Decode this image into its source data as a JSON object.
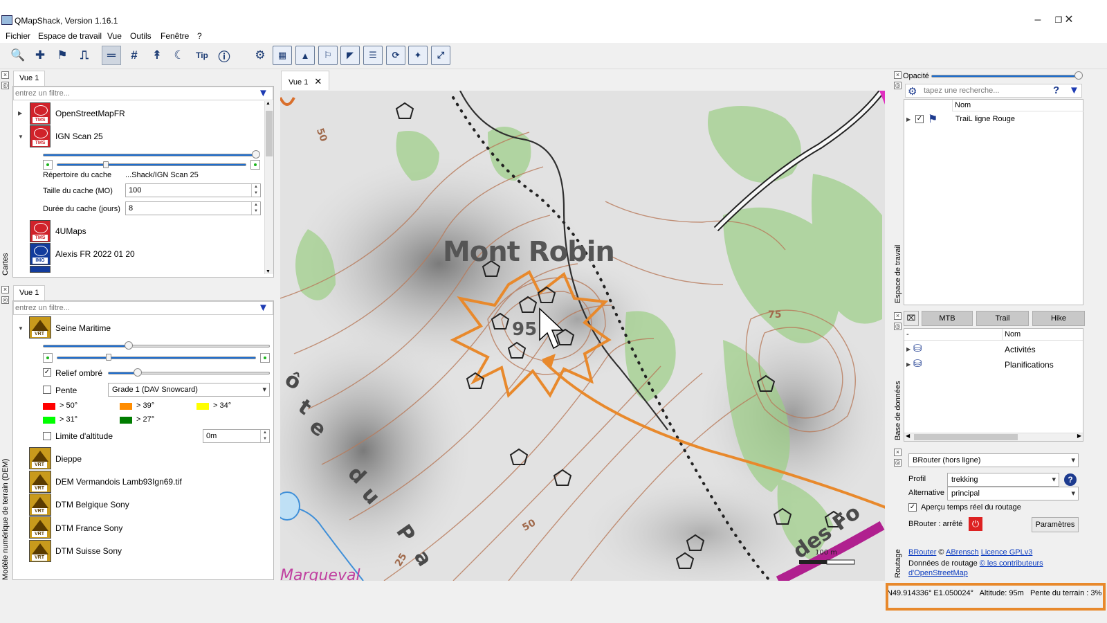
{
  "window": {
    "title": "QMapShack, Version 1.16.1"
  },
  "menu": [
    "Fichier",
    "Espace de travail",
    "Vue",
    "Outils",
    "Fenêtre",
    "?"
  ],
  "maps_dock": {
    "side_label": "Cartes",
    "tab": "Vue 1",
    "filter_placeholder": "entrez un filtre...",
    "items": [
      {
        "name": "OpenStreetMapFR",
        "type": "TMS"
      },
      {
        "name": "IGN Scan 25",
        "type": "TMS"
      },
      {
        "name": "4UMaps",
        "type": "TMS"
      },
      {
        "name": "Alexis FR 2022 01 20",
        "type": "IMG"
      }
    ],
    "cache_dir_label": "Répertoire du cache",
    "cache_dir_value": "...Shack/IGN Scan 25",
    "cache_size_label": "Taille du cache (MO)",
    "cache_size_value": "100",
    "cache_days_label": "Durée du cache (jours)",
    "cache_days_value": "8",
    "opacity_level": 0.98
  },
  "dem_dock": {
    "side_label": "Modèle numérique de terrain (DEM)",
    "tab": "Vue 1",
    "filter_placeholder": "entrez un filtre...",
    "items": [
      {
        "name": "Seine Maritime",
        "type": "VRT"
      },
      {
        "name": "Dieppe",
        "type": "VRT"
      },
      {
        "name": "DEM Vermandois Lamb93Ign69.tif",
        "type": "VRT"
      },
      {
        "name": "DTM Belgique Sony",
        "type": "VRT"
      },
      {
        "name": "DTM France Sony",
        "type": "VRT"
      },
      {
        "name": "DTM Suisse Sony",
        "type": "VRT"
      }
    ],
    "hillshade_label": "Relief ombré",
    "slope_label": "Pente",
    "slope_option": "Grade 1 (DAV Snowcard)",
    "slope_legend": [
      "> 50°",
      "> 39°",
      "> 34°",
      "> 31°",
      "> 27°"
    ],
    "slope_colors": [
      "#ff0000",
      "#ff8c00",
      "#ffff00",
      "#00ff00",
      "#007d00"
    ],
    "alt_limit_label": "Limite d'altitude",
    "alt_limit_value": "0m"
  },
  "map_view": {
    "tab": "Vue 1",
    "peak_label": "Mont Robin",
    "peak_alt": "95",
    "contour_labels": [
      "50",
      "75",
      "50",
      "25"
    ],
    "scale_label": "100 m",
    "road_label_letters": [
      "ô",
      "t",
      "e",
      "d",
      "u",
      "P",
      "a"
    ],
    "road_label_2": "des Fo",
    "village": "Marqueval"
  },
  "workspace_dock": {
    "side_label": "Espace de travail",
    "opacity_label": "Opacité",
    "opacity_level": 1.0,
    "search_placeholder": "tapez une recherche...",
    "help": "?",
    "column": "Nom",
    "items": [
      {
        "name": "TraiL ligne Rouge",
        "checked": true
      }
    ]
  },
  "db_dock": {
    "side_label": "Base de données",
    "tabs": [
      "MTB",
      "Trail",
      "Hike"
    ],
    "column_left": "-",
    "column": "Nom",
    "items": [
      "Activités",
      "Planifications"
    ]
  },
  "routing_dock": {
    "side_label": "Routage",
    "engine": "BRouter (hors ligne)",
    "profile_label": "Profil",
    "profile_value": "trekking",
    "alternative_label": "Alternative",
    "alternative_value": "principal",
    "preview_label": "Aperçu temps réel du routage",
    "status_label": "BRouter : arrêté",
    "params_button": "Paramètres",
    "credit_link1": "BRouter",
    "credit_copy": "©",
    "credit_link2": "ABrensch",
    "credit_link3": "Licence GPLv3",
    "data_label": "Données de routage",
    "data_link": "© les contributeurs",
    "data_link2": "d'OpenStreetMap"
  },
  "status": {
    "coords": "N49.914336° E1.050024°",
    "altitude": "Altitude: 95m",
    "slope": "Pente du terrain : 3%"
  },
  "colors": {
    "accent": "#e8892c",
    "filter": "#1d3bb3"
  }
}
